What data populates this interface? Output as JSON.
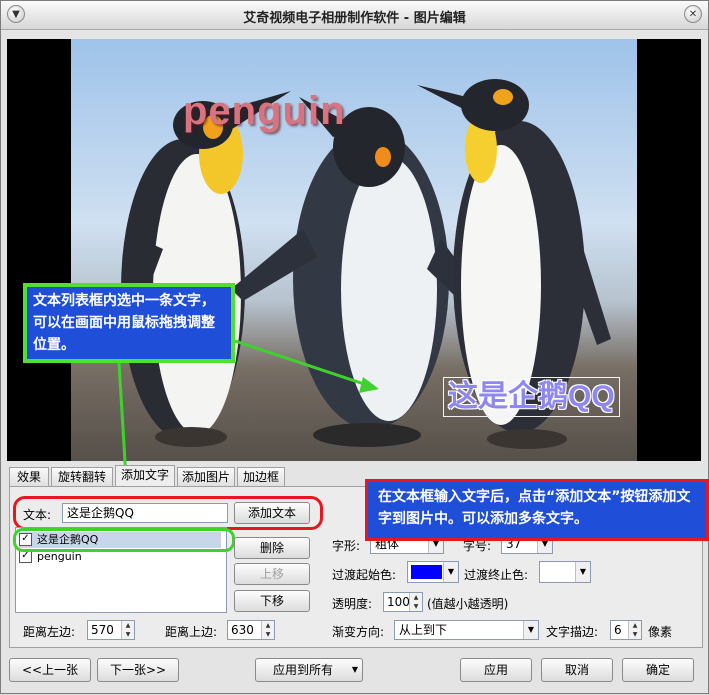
{
  "window": {
    "title": "艾奇视频电子相册制作软件 - 图片编辑"
  },
  "preview": {
    "overlay_texts": [
      "penguin",
      "这是企鹅QQ"
    ],
    "callout_green": "文本列表框内选中一条文字，可以在画面中用鼠标拖拽调整位置。"
  },
  "tabs": [
    {
      "label": "效果"
    },
    {
      "label": "旋转翻转"
    },
    {
      "label": "添加文字"
    },
    {
      "label": "添加图片"
    },
    {
      "label": "加边框"
    }
  ],
  "text_panel": {
    "text_label": "文本:",
    "text_value": "这是企鹅QQ",
    "add_text_button": "添加文本",
    "list_items": [
      {
        "label": "这是企鹅QQ",
        "checked": true,
        "selected": true
      },
      {
        "label": "penguin",
        "checked": true,
        "selected": false
      }
    ],
    "delete_button": "删除",
    "move_up_button": "上移",
    "move_down_button": "下移",
    "left_distance_label": "距离左边:",
    "left_distance_value": "570",
    "top_distance_label": "距离上边:",
    "top_distance_value": "630",
    "font_style_label": "字形:",
    "font_style_value": "粗体",
    "font_size_label": "字号:",
    "font_size_value": "37",
    "gradient_start_label": "过渡起始色:",
    "gradient_start_color": "#0000ff",
    "gradient_end_label": "过渡终止色:",
    "gradient_end_color": "#ffffff",
    "opacity_label": "透明度:",
    "opacity_value": "100",
    "opacity_hint": "(值越小越透明)",
    "gradient_direction_label": "渐变方向:",
    "gradient_direction_value": "从上到下",
    "stroke_label": "文字描边:",
    "stroke_value": "6",
    "stroke_unit": "像素"
  },
  "callout_red": "在文本框输入文字后，点击“添加文本”按钮添加文字到图片中。可以添加多条文字。",
  "footer": {
    "prev_button": "<<上一张",
    "next_button": "下一张>>",
    "apply_all_button": "应用到所有",
    "apply_button": "应用",
    "cancel_button": "取消",
    "ok_button": "确定"
  },
  "colors": {
    "callout_bg": "#1f4fd9",
    "red_highlight": "#e8161e",
    "green_highlight": "#3fd22d"
  }
}
